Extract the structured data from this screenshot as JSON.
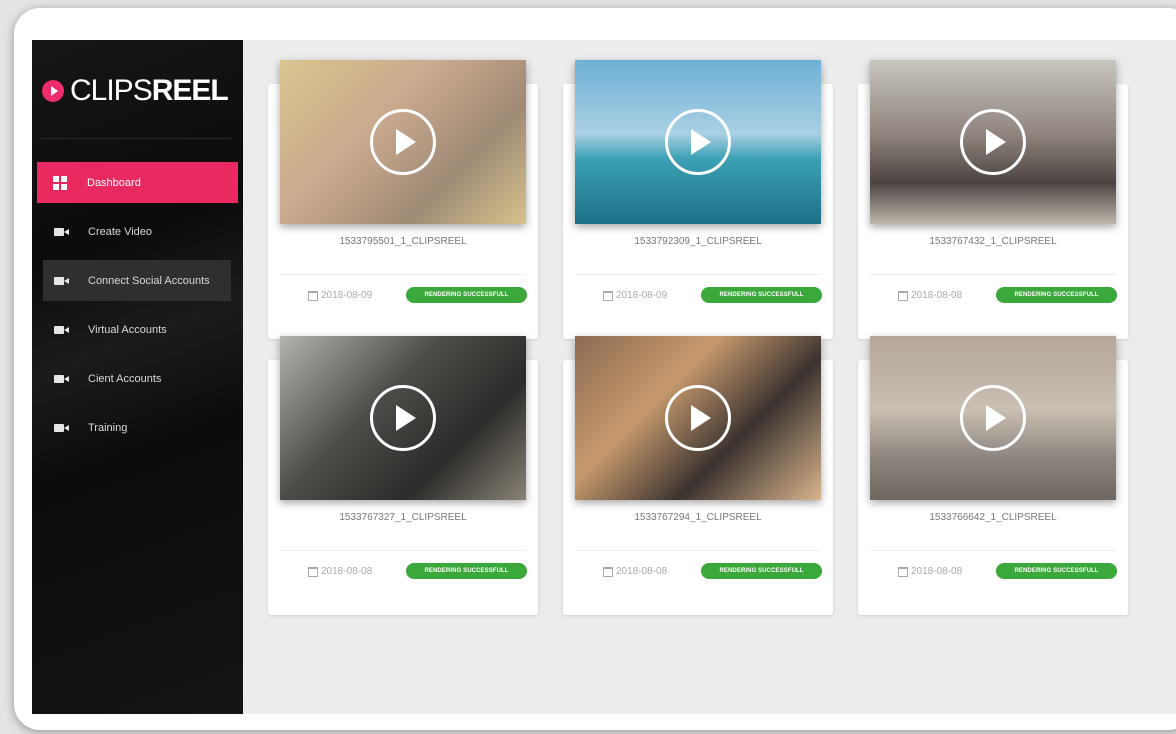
{
  "app": {
    "logo_light": "CLIPS",
    "logo_bold": "REEL",
    "accent_color": "#e9295f",
    "success_color": "#3aa83a"
  },
  "sidebar": {
    "items": [
      {
        "label": "Dashboard",
        "icon": "dashboard-grid-icon",
        "state": "active"
      },
      {
        "label": "Create Video",
        "icon": "video-camera-icon",
        "state": "normal"
      },
      {
        "label": "Connect Social Accounts",
        "icon": "video-camera-icon",
        "state": "hover"
      },
      {
        "label": "Virtual Accounts",
        "icon": "video-camera-icon",
        "state": "normal"
      },
      {
        "label": "Cient Accounts",
        "icon": "video-camera-icon",
        "state": "normal"
      },
      {
        "label": "Training",
        "icon": "video-camera-icon",
        "state": "normal"
      }
    ]
  },
  "videos": [
    {
      "name": "1533795501_1_CLIPSREEL",
      "date": "2018-08-09",
      "status": "RENDERING SUCCESSFULL"
    },
    {
      "name": "1533792309_1_CLIPSREEL",
      "date": "2018-08-09",
      "status": "RENDERING SUCCESSFULL"
    },
    {
      "name": "1533767432_1_CLIPSREEL",
      "date": "2018-08-08",
      "status": "RENDERING SUCCESSFULL"
    },
    {
      "name": "1533767327_1_CLIPSREEL",
      "date": "2018-08-08",
      "status": "RENDERING SUCCESSFULL"
    },
    {
      "name": "1533767294_1_CLIPSREEL",
      "date": "2018-08-08",
      "status": "RENDERING SUCCESSFULL"
    },
    {
      "name": "1533766642_1_CLIPSREEL",
      "date": "2018-08-08",
      "status": "RENDERING SUCCESSFULL"
    }
  ]
}
